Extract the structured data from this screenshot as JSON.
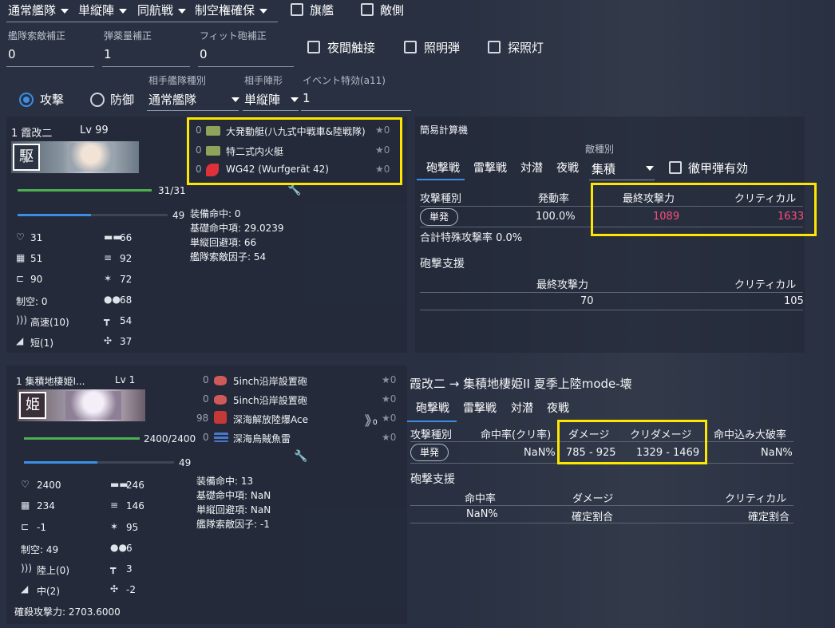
{
  "top": {
    "fleet_type": "通常艦隊",
    "formation": "単縦陣",
    "battle_type": "同航戦",
    "air_state": "制空権確保",
    "flagship_label": "旗艦",
    "enemy_side_label": "敵側"
  },
  "modifiers": {
    "scout_label": "艦隊索敵補正",
    "scout_value": "0",
    "ammo_label": "弾薬量補正",
    "ammo_value": "1",
    "fit_label": "フィット砲補正",
    "fit_value": "0",
    "night_contact": "夜間触接",
    "star_shell": "照明弾",
    "searchlight": "探照灯"
  },
  "mode": {
    "attack": "攻撃",
    "defense": "防御",
    "enemy_fleet_label": "相手艦隊種別",
    "enemy_fleet_value": "通常艦隊",
    "enemy_form_label": "相手陣形",
    "enemy_form_value": "単縦陣",
    "event_label": "イベント特効(a11)",
    "event_value": "1"
  },
  "ship1": {
    "name": "1 霞改二",
    "level": "Lv 99",
    "hp": "31/31",
    "hp_fill": 1.0,
    "morale": "49",
    "morale_fill": 0.49,
    "equipment": [
      {
        "slot": "0",
        "name": "大発動艇(八九式中戦車&陸戦隊)",
        "star": "★0",
        "icon": "landing-craft-icon",
        "color": "#8fa35a"
      },
      {
        "slot": "0",
        "name": "特二式内火艇",
        "star": "★0",
        "icon": "amphibious-tank-icon",
        "color": "#8fa35a"
      },
      {
        "slot": "0",
        "name": "WG42 (Wurfgerät 42)",
        "star": "★0",
        "icon": "rocket-launcher-icon",
        "color": "#e0303a"
      }
    ],
    "acc_equip": "装備命中: 0",
    "acc_base": "基礎命中項: 29.0239",
    "evasion": "単縦回避項: 66",
    "scout_factor": "艦隊索敵因子: 54",
    "stats": {
      "hp": "31",
      "fp": "66",
      "armor": "51",
      "torp": "92",
      "eva": "90",
      "aa": "72",
      "air": "制空: 0",
      "asw": "68",
      "speed": "高速(10)",
      "los": "54",
      "range": "短(1)",
      "luck": "37"
    }
  },
  "calc": {
    "title": "簡易計算機",
    "tabs": [
      "砲撃戦",
      "雷撃戦",
      "対潜",
      "夜戦"
    ],
    "enemy_type_label": "敵種別",
    "enemy_type_value": "集積",
    "ap_label": "徹甲弾有効",
    "col_attack_type": "攻撃種別",
    "col_trigger": "発動率",
    "col_final": "最終攻撃力",
    "col_crit": "クリティカル",
    "row_type": "単発",
    "row_rate": "100.0%",
    "row_final": "1089",
    "row_crit": "1633",
    "special_rate": "合計特殊攻撃率 0.0%",
    "support_title": "砲撃支援",
    "support_final_label": "最終攻撃力",
    "support_crit_label": "クリティカル",
    "support_final": "70",
    "support_crit": "105"
  },
  "ship2": {
    "name": "1 集積地棲姫I...",
    "level": "Lv 1",
    "hp": "2400/2400",
    "hp_fill": 1.0,
    "morale": "49",
    "morale_fill": 0.49,
    "equipment": [
      {
        "slot": "0",
        "name": "5inch沿岸設置砲",
        "star": "★0",
        "icon": "coastal-gun-icon",
        "color": "#d05a5a"
      },
      {
        "slot": "0",
        "name": "5inch沿岸設置砲",
        "star": "★0",
        "icon": "coastal-gun-icon",
        "color": "#d05a5a"
      },
      {
        "slot": "98",
        "name": "深海解放陸爆Ace",
        "star": "★0",
        "icon": "abyssal-bomber-icon",
        "color": "#c43838"
      },
      {
        "slot": "0",
        "name": "深海烏賊魚雷",
        "star": "★0",
        "icon": "abyssal-torpedo-icon",
        "color": "#4a78c8"
      }
    ],
    "proficiency": "0",
    "acc_equip": "装備命中: 13",
    "acc_base": "基礎命中項: NaN",
    "evasion": "単縦回避項: NaN",
    "scout_factor": "艦隊索敵因子: -1",
    "kill_power": "確殺攻撃力: 2703.6000",
    "stats": {
      "hp": "2400",
      "fp": "246",
      "armor": "234",
      "torp": "146",
      "eva": "-1",
      "aa": "95",
      "air": "制空: 49",
      "asw": "6",
      "speed": "陸上(0)",
      "los": "3",
      "range": "中(2)",
      "luck": "-2"
    }
  },
  "result": {
    "title": "霞改二 → 集積地棲姫II 夏季上陸mode-壊",
    "tabs": [
      "砲撃戦",
      "雷撃戦",
      "対潜",
      "夜戦"
    ],
    "col_type": "攻撃種別",
    "col_hit": "命中率(クリ率)",
    "col_damage": "ダメージ",
    "col_crit_damage": "クリダメージ",
    "col_heavy": "命中込み大破率",
    "row_type": "単発",
    "row_hit": "NaN%",
    "row_damage": "785 - 925",
    "row_crit_damage": "1329 - 1469",
    "row_heavy": "NaN%",
    "support_title": "砲撃支援",
    "support_col_hit": "命中率",
    "support_col_damage": "ダメージ",
    "support_col_crit": "クリティカル",
    "support_hit": "NaN%",
    "support_damage": "確定割合",
    "support_crit": "確定割合"
  }
}
